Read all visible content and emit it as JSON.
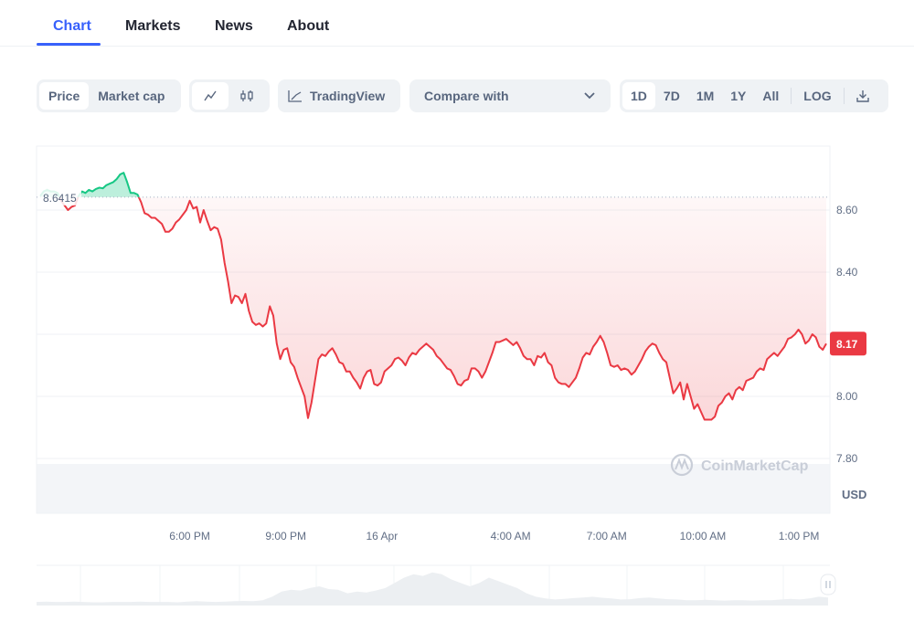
{
  "tabs": [
    {
      "label": "Chart",
      "active": true
    },
    {
      "label": "Markets",
      "active": false
    },
    {
      "label": "News",
      "active": false
    },
    {
      "label": "About",
      "active": false
    }
  ],
  "toolbar": {
    "metric": [
      {
        "label": "Price",
        "active": true
      },
      {
        "label": "Market cap",
        "active": false
      }
    ],
    "chart_types": [
      {
        "icon": "line-chart-icon",
        "active": true
      },
      {
        "icon": "candlestick-icon",
        "active": false
      }
    ],
    "tradingview_label": "TradingView",
    "compare_label": "Compare with",
    "ranges": [
      {
        "label": "1D",
        "active": true
      },
      {
        "label": "7D",
        "active": false
      },
      {
        "label": "1M",
        "active": false
      },
      {
        "label": "1Y",
        "active": false
      },
      {
        "label": "All",
        "active": false
      }
    ],
    "log_label": "LOG",
    "download_icon": "download-icon"
  },
  "colors": {
    "accent": "#3861fb",
    "up": "#16c784",
    "down": "#ea3943",
    "grid": "#eff2f5",
    "axis_text": "#616e85"
  },
  "watermark": "CoinMarketCap",
  "chart_data": {
    "type": "line",
    "title": "",
    "xlabel": "",
    "ylabel": "USD",
    "currency_label": "USD",
    "reference_price": 8.6415,
    "reference_label": "8.6415",
    "current_price": 8.17,
    "current_label": "8.17",
    "ylim": [
      7.78,
      8.82
    ],
    "y_ticks": [
      7.8,
      8.0,
      8.2,
      8.4,
      8.6
    ],
    "y_tick_labels": [
      "7.80",
      "8.00",
      "",
      "8.40",
      "8.60"
    ],
    "x_ticks": [
      {
        "label": "6:00 PM",
        "pos": 0.174
      },
      {
        "label": "9:00 PM",
        "pos": 0.298
      },
      {
        "label": "16 Apr",
        "pos": 0.422
      },
      {
        "label": "4:00 AM",
        "pos": 0.588
      },
      {
        "label": "7:00 AM",
        "pos": 0.712
      },
      {
        "label": "10:00 AM",
        "pos": 0.836
      },
      {
        "label": "1:00 PM",
        "pos": 0.96
      }
    ],
    "grid": true,
    "legend": "none",
    "prices": [
      8.645,
      8.66,
      8.665,
      8.66,
      8.66,
      8.655,
      8.63,
      8.615,
      8.6,
      8.61,
      8.615,
      8.645,
      8.66,
      8.655,
      8.665,
      8.66,
      8.668,
      8.672,
      8.67,
      8.68,
      8.685,
      8.69,
      8.7,
      8.715,
      8.72,
      8.69,
      8.655,
      8.655,
      8.65,
      8.625,
      8.59,
      8.585,
      8.575,
      8.575,
      8.565,
      8.555,
      8.53,
      8.53,
      8.54,
      8.56,
      8.57,
      8.585,
      8.6,
      8.63,
      8.605,
      8.61,
      8.56,
      8.6,
      8.565,
      8.535,
      8.545,
      8.54,
      8.505,
      8.43,
      8.37,
      8.3,
      8.325,
      8.32,
      8.3,
      8.33,
      8.275,
      8.24,
      8.23,
      8.235,
      8.225,
      8.235,
      8.29,
      8.26,
      8.17,
      8.12,
      8.15,
      8.155,
      8.11,
      8.095,
      8.06,
      8.03,
      8.0,
      7.93,
      7.98,
      8.05,
      8.12,
      8.135,
      8.13,
      8.145,
      8.155,
      8.135,
      8.11,
      8.105,
      8.08,
      8.08,
      8.06,
      8.045,
      8.025,
      8.06,
      8.08,
      8.085,
      8.04,
      8.035,
      8.045,
      8.08,
      8.09,
      8.1,
      8.12,
      8.125,
      8.115,
      8.1,
      8.125,
      8.14,
      8.135,
      8.15,
      8.16,
      8.17,
      8.16,
      8.15,
      8.13,
      8.12,
      8.105,
      8.09,
      8.085,
      8.065,
      8.04,
      8.035,
      8.05,
      8.055,
      8.09,
      8.09,
      8.08,
      8.06,
      8.08,
      8.11,
      8.14,
      8.175,
      8.175,
      8.18,
      8.185,
      8.175,
      8.165,
      8.175,
      8.155,
      8.13,
      8.12,
      8.12,
      8.1,
      8.13,
      8.125,
      8.14,
      8.11,
      8.1,
      8.06,
      8.045,
      8.04,
      8.04,
      8.03,
      8.045,
      8.06,
      8.09,
      8.125,
      8.14,
      8.135,
      8.16,
      8.175,
      8.195,
      8.175,
      8.14,
      8.1,
      8.095,
      8.1,
      8.085,
      8.09,
      8.085,
      8.07,
      8.08,
      8.1,
      8.12,
      8.145,
      8.16,
      8.17,
      8.165,
      8.14,
      8.12,
      8.11,
      8.06,
      8.01,
      8.025,
      8.045,
      7.99,
      8.04,
      8.0,
      7.96,
      7.975,
      7.95,
      7.925,
      7.925,
      7.925,
      7.935,
      7.97,
      7.98,
      8.0,
      8.01,
      7.99,
      8.02,
      8.03,
      8.02,
      8.05,
      8.055,
      8.06,
      8.08,
      8.09,
      8.085,
      8.12,
      8.13,
      8.14,
      8.13,
      8.145,
      8.16,
      8.185,
      8.19,
      8.2,
      8.215,
      8.2,
      8.17,
      8.18,
      8.2,
      8.19,
      8.16,
      8.15,
      8.17
    ],
    "volume_profile": [
      0.05,
      0.06,
      0.05,
      0.05,
      0.06,
      0.05,
      0.04,
      0.04,
      0.05,
      0.05,
      0.05,
      0.06,
      0.05,
      0.05,
      0.05,
      0.04,
      0.06,
      0.07,
      0.06,
      0.05,
      0.06,
      0.07,
      0.08,
      0.07,
      0.1,
      0.2,
      0.35,
      0.4,
      0.38,
      0.45,
      0.5,
      0.42,
      0.4,
      0.3,
      0.35,
      0.32,
      0.38,
      0.45,
      0.6,
      0.75,
      0.85,
      0.8,
      0.9,
      0.85,
      0.7,
      0.6,
      0.5,
      0.6,
      0.75,
      0.65,
      0.55,
      0.45,
      0.3,
      0.2,
      0.15,
      0.12,
      0.14,
      0.16,
      0.18,
      0.2,
      0.17,
      0.15,
      0.12,
      0.13,
      0.16,
      0.18,
      0.15,
      0.13,
      0.12,
      0.1,
      0.1,
      0.11,
      0.1,
      0.09,
      0.1,
      0.1,
      0.09,
      0.1,
      0.1,
      0.12,
      0.14,
      0.12,
      0.15,
      0.2,
      0.18
    ]
  }
}
